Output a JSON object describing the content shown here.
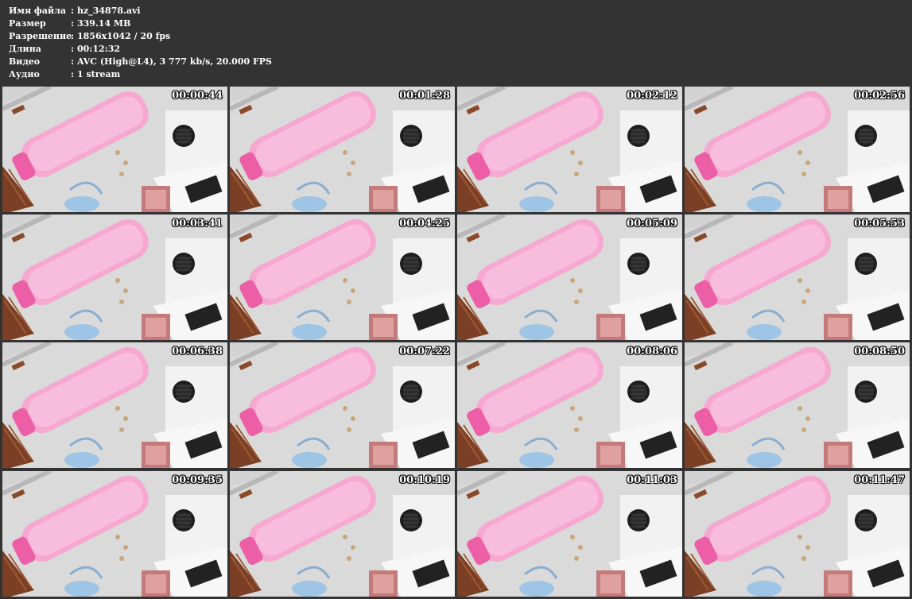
{
  "info": [
    {
      "key": "Имя файла",
      "sep": ":",
      "value": "hz_34878.avi"
    },
    {
      "key": "Размер",
      "sep": ":",
      "value": "339.14 MB"
    },
    {
      "key": "Разрешение",
      "sep": ":",
      "value": "1856x1042 / 20 fps"
    },
    {
      "key": "Длина",
      "sep": ":",
      "value": "00:12:32"
    },
    {
      "key": "Видео",
      "sep": ":",
      "value": "AVC (High@L4), 3 777 kb/s, 20.000 FPS"
    },
    {
      "key": "Аудио",
      "sep": ":",
      "value": "1 stream"
    }
  ],
  "thumbnails": [
    {
      "time": "00:00:44"
    },
    {
      "time": "00:01:28"
    },
    {
      "time": "00:02:12"
    },
    {
      "time": "00:02:56"
    },
    {
      "time": "00:03:41"
    },
    {
      "time": "00:04:25"
    },
    {
      "time": "00:05:09"
    },
    {
      "time": "00:05:53"
    },
    {
      "time": "00:06:38"
    },
    {
      "time": "00:07:22"
    },
    {
      "time": "00:08:06"
    },
    {
      "time": "00:08:50"
    },
    {
      "time": "00:09:35"
    },
    {
      "time": "00:10:19"
    },
    {
      "time": "00:11:03"
    },
    {
      "time": "00:11:47"
    }
  ],
  "colors": {
    "background": "#333333",
    "text": "#ffffff",
    "floor": "#d4d4d4",
    "bed": "#f4a6cf",
    "furniture": "#ffffff",
    "cabinet": "#8a4a2a",
    "chair": "#1e1e1e"
  }
}
